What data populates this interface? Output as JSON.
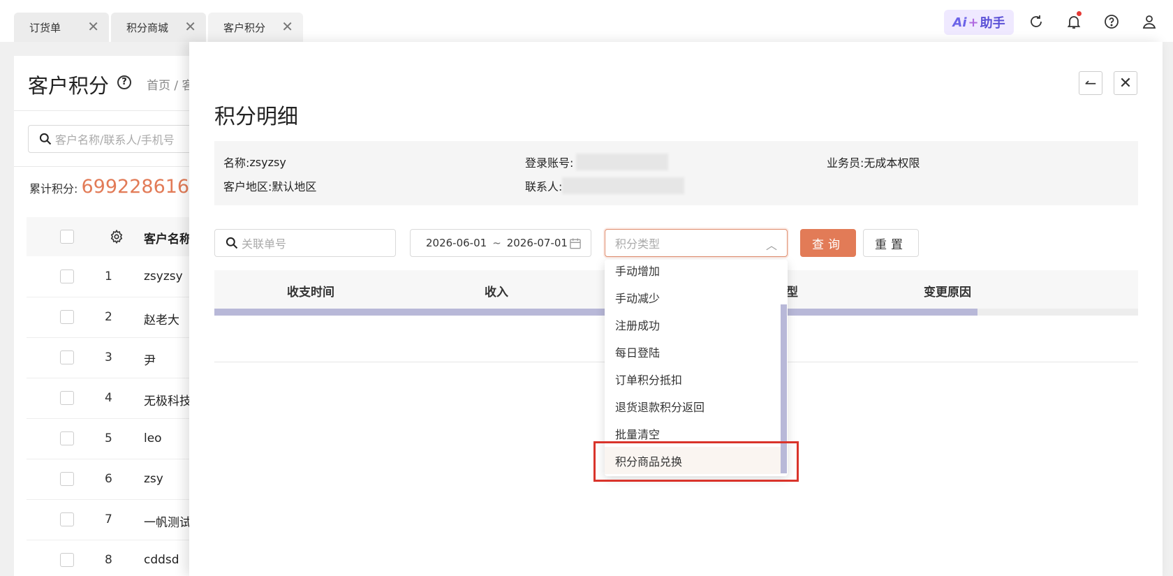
{
  "tabs": [
    {
      "label": "订货单"
    },
    {
      "label": "积分商城"
    },
    {
      "label": "客户积分"
    }
  ],
  "topbar": {
    "ai_logo": "Ai",
    "ai_plus": "+",
    "ai_label": "助手"
  },
  "bg_page": {
    "title": "客户积分",
    "help": "?",
    "breadcrumb": "首页 / 客",
    "search_placeholder": "客户名称/联系人/手机号",
    "total_label": "累计积分:",
    "total_value": "699228616",
    "table_header_name": "客户名称",
    "rows": [
      {
        "index": "1",
        "name": "zsyzsy"
      },
      {
        "index": "2",
        "name": "赵老大"
      },
      {
        "index": "3",
        "name": "尹"
      },
      {
        "index": "4",
        "name": "无极科技"
      },
      {
        "index": "5",
        "name": "leo"
      },
      {
        "index": "6",
        "name": "zsy"
      },
      {
        "index": "7",
        "name": "一帆测试帐"
      },
      {
        "index": "8",
        "name": "cddsd"
      }
    ]
  },
  "drawer": {
    "title": "积分明细",
    "back_icon": "↼",
    "close_icon": "✕",
    "info": {
      "name_label": "名称:",
      "name_value": "zsyzsy",
      "login_label": "登录账号:",
      "salesman_label": "业务员:",
      "salesman_value": "无成本权限",
      "region_label": "客户地区:",
      "region_value": "默认地区",
      "contact_label": "联系人:"
    },
    "filters": {
      "search_placeholder": "关联单号",
      "date_start": "2026-06-01",
      "date_sep": "~",
      "date_end": "2026-07-01",
      "type_placeholder": "积分类型",
      "query_label": "查询",
      "reset_label": "重置"
    },
    "table_headers": {
      "time": "收支时间",
      "income": "收入",
      "type_tail": "型",
      "reason": "变更原因"
    },
    "type_options": [
      "手动增加",
      "手动减少",
      "注册成功",
      "每日登陆",
      "订单积分抵扣",
      "退货退款积分返回",
      "批量清空",
      "积分商品兑换"
    ]
  },
  "colors": {
    "accent": "#e27b57",
    "highlight": "#d9342b",
    "scrollbar": "#b8b8d8"
  }
}
